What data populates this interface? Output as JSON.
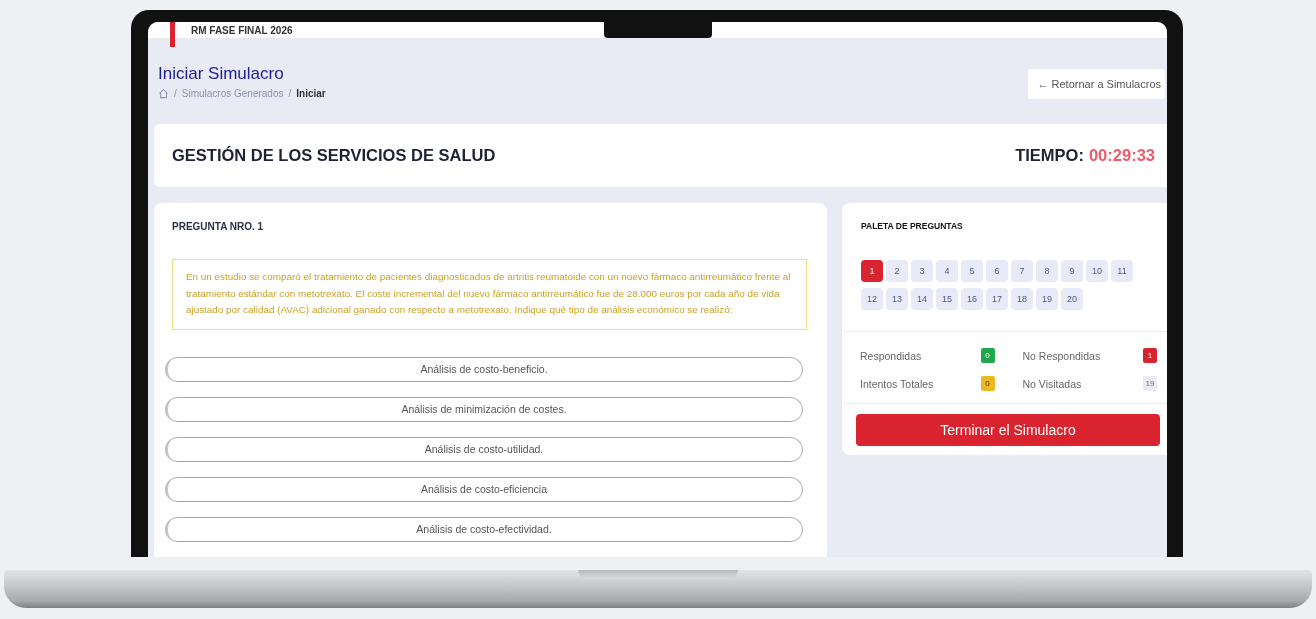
{
  "app": {
    "brand": "RM FASE FINAL 2026"
  },
  "page": {
    "title": "Iniciar Simulacro",
    "back_button": {
      "arrow": "←",
      "label": "Retornar a Simulacros"
    },
    "breadcrumb": {
      "separator": "/",
      "items": [
        {
          "label": "Simulacros Generados",
          "current": false
        },
        {
          "label": "Iniciar",
          "current": true
        }
      ]
    }
  },
  "exam": {
    "title": "GESTIÓN DE LOS SERVICIOS DE SALUD",
    "timer_label": "TIEMPO:",
    "timer": "00:29:33"
  },
  "question": {
    "heading": "PREGUNTA NRO. 1",
    "text": "En un estudio se comparó el tratamiento de pacientes diagnosticados de artritis reumatoide con un nuevo fármaco antirreumático frente al tratamiento estándar con metotrexato. El coste incremental del nuevo fármaco antirreumático fue de 28.000 euros por cada año de vida ajustado por calidad (AVAC) adicional ganado con respecto a metotrexato. Indique qué tipo de análisis económico se realizó:",
    "options": [
      "Análisis de costo-beneficio.",
      "Análisis de minimización de costes.",
      "Análisis de costo-utilidad.",
      "Análisis de costo-eficiencia",
      "Análisis de costo-efectividad."
    ]
  },
  "palette": {
    "title": "PALETA DE PREGUNTAS",
    "questions": [
      {
        "label": "1",
        "selected": true
      },
      {
        "label": "2",
        "selected": false
      },
      {
        "label": "3",
        "selected": false
      },
      {
        "label": "4",
        "selected": false
      },
      {
        "label": "5",
        "selected": false
      },
      {
        "label": "6",
        "selected": false
      },
      {
        "label": "7",
        "selected": false
      },
      {
        "label": "8",
        "selected": false
      },
      {
        "label": "9",
        "selected": false
      },
      {
        "label": "10",
        "selected": false
      },
      {
        "label": "11",
        "selected": false
      },
      {
        "label": "12",
        "selected": false
      },
      {
        "label": "13",
        "selected": false
      },
      {
        "label": "14",
        "selected": false
      },
      {
        "label": "15",
        "selected": false
      },
      {
        "label": "16",
        "selected": false
      },
      {
        "label": "17",
        "selected": false
      },
      {
        "label": "18",
        "selected": false
      },
      {
        "label": "19",
        "selected": false
      },
      {
        "label": "20",
        "selected": false
      }
    ],
    "stats": [
      {
        "label": "Respondidas",
        "count": "0",
        "color": "#22a84a"
      },
      {
        "label": "No Respondidas",
        "count": "1",
        "color": "#d9232e"
      },
      {
        "label": "Intentos Totales",
        "count": "0",
        "color": "#e9b824"
      },
      {
        "label": "No Visitadas",
        "count": "19",
        "color": "#e8eaf4"
      }
    ],
    "finish_button": "Terminar el Simulacro"
  }
}
